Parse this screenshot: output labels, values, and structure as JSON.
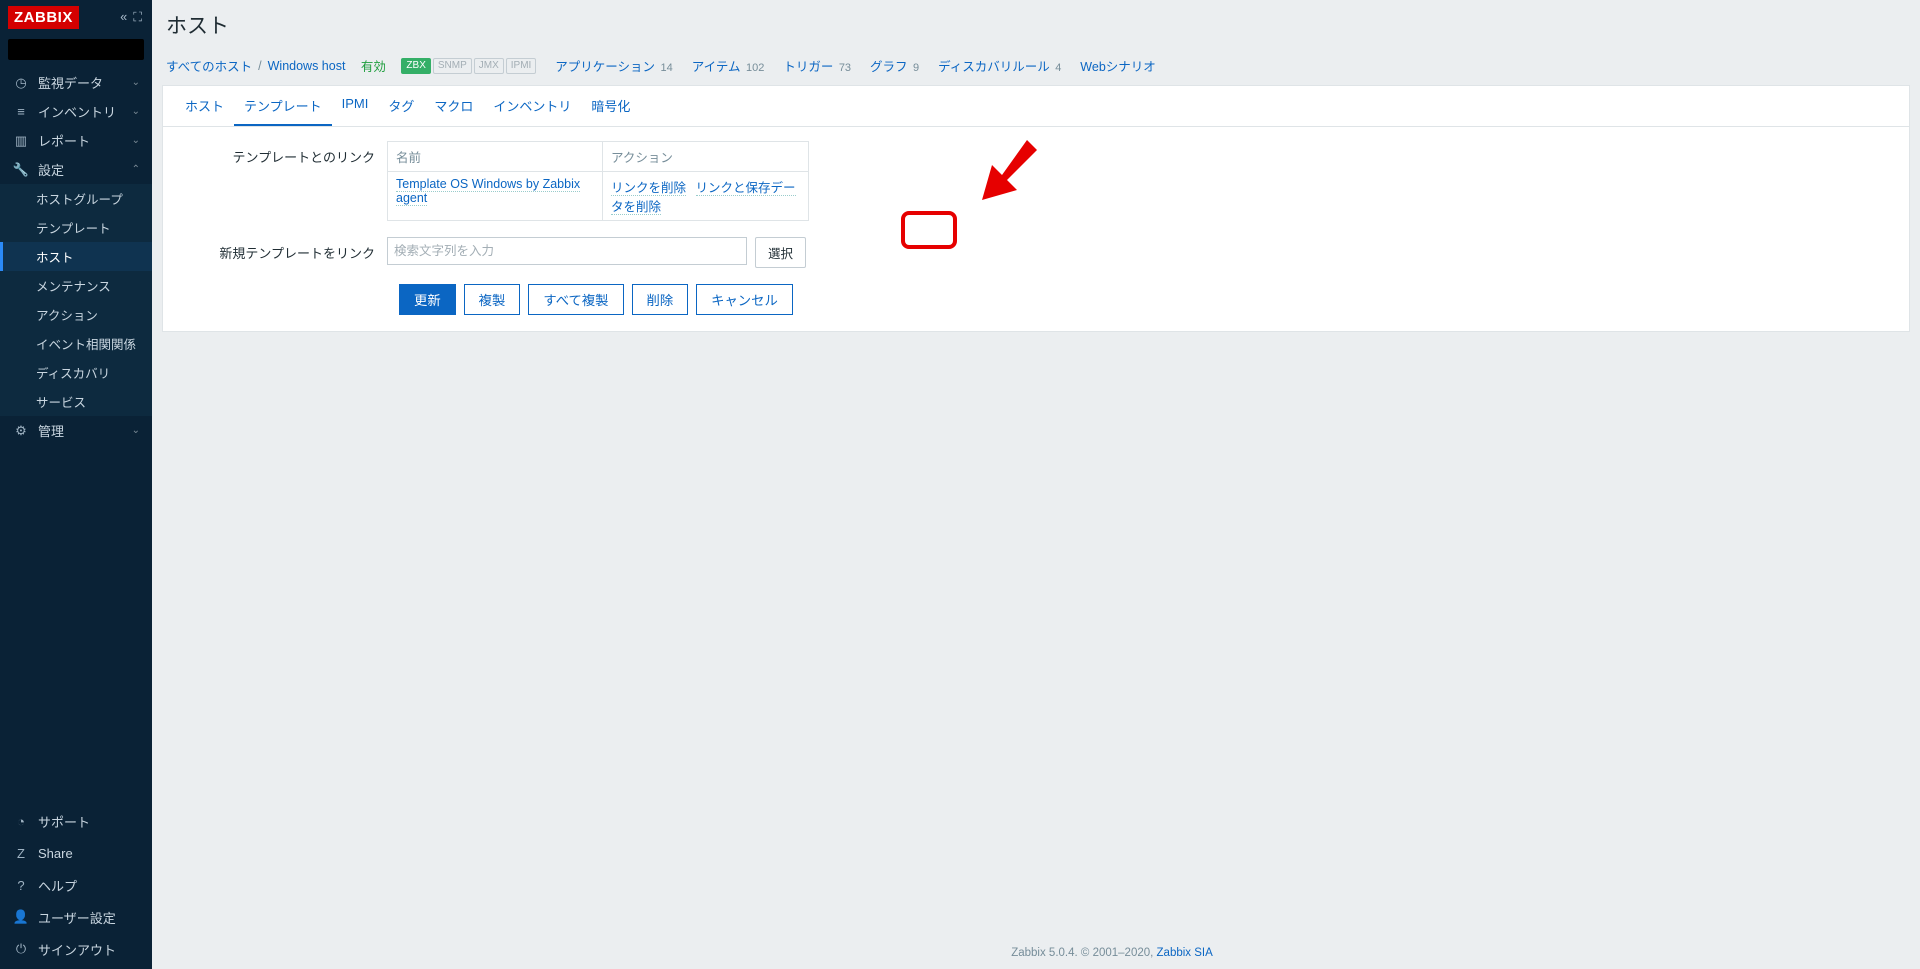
{
  "brand": "ZABBIX",
  "search": {
    "placeholder": ""
  },
  "sidebar": {
    "main": [
      {
        "icon": "◷",
        "label": "監視データ"
      },
      {
        "icon": "≡",
        "label": "インベントリ"
      },
      {
        "icon": "▥",
        "label": "レポート"
      },
      {
        "icon": "🔧",
        "label": "設定",
        "expanded": true
      },
      {
        "icon": "⚙",
        "label": "管理"
      }
    ],
    "settings_sub": [
      {
        "label": "ホストグループ"
      },
      {
        "label": "テンプレート"
      },
      {
        "label": "ホスト",
        "active": true
      },
      {
        "label": "メンテナンス"
      },
      {
        "label": "アクション"
      },
      {
        "label": "イベント相関関係"
      },
      {
        "label": "ディスカバリ"
      },
      {
        "label": "サービス"
      }
    ],
    "bottom": [
      {
        "icon": "◔",
        "label": "サポート"
      },
      {
        "icon": "Z",
        "label": "Share"
      },
      {
        "icon": "?",
        "label": "ヘルプ"
      },
      {
        "icon": "👤",
        "label": "ユーザー設定"
      },
      {
        "icon": "⏻",
        "label": "サインアウト"
      }
    ]
  },
  "page": {
    "title": "ホスト"
  },
  "breadcrumb": {
    "all_hosts": "すべてのホスト",
    "host_name": "Windows host",
    "status": "有効",
    "badge_zbx": "ZBX",
    "badge_snmp": "SNMP",
    "badge_jmx": "JMX",
    "badge_ipmi": "IPMI",
    "links": [
      {
        "label": "アプリケーション",
        "count": "14"
      },
      {
        "label": "アイテム",
        "count": "102"
      },
      {
        "label": "トリガー",
        "count": "73"
      },
      {
        "label": "グラフ",
        "count": "9"
      },
      {
        "label": "ディスカバリルール",
        "count": "4"
      },
      {
        "label": "Webシナリオ",
        "count": ""
      }
    ]
  },
  "tabs": [
    {
      "label": "ホスト"
    },
    {
      "label": "テンプレート",
      "active": true
    },
    {
      "label": "IPMI"
    },
    {
      "label": "タグ"
    },
    {
      "label": "マクロ"
    },
    {
      "label": "インベントリ"
    },
    {
      "label": "暗号化"
    }
  ],
  "form": {
    "linked_label": "テンプレートとのリンク",
    "col_name": "名前",
    "col_action": "アクション",
    "linked_templates": [
      {
        "name": "Template OS Windows by Zabbix agent",
        "unlink": "リンクを削除",
        "unlink_clear": "リンクと保存データを削除"
      }
    ],
    "link_new_label": "新規テンプレートをリンク",
    "link_new_placeholder": "検索文字列を入力",
    "select_btn": "選択"
  },
  "buttons": {
    "update": "更新",
    "clone": "複製",
    "full_clone": "すべて複製",
    "delete": "削除",
    "cancel": "キャンセル"
  },
  "footer": {
    "text": "Zabbix 5.0.4. © 2001–2020, ",
    "link": "Zabbix SIA"
  }
}
